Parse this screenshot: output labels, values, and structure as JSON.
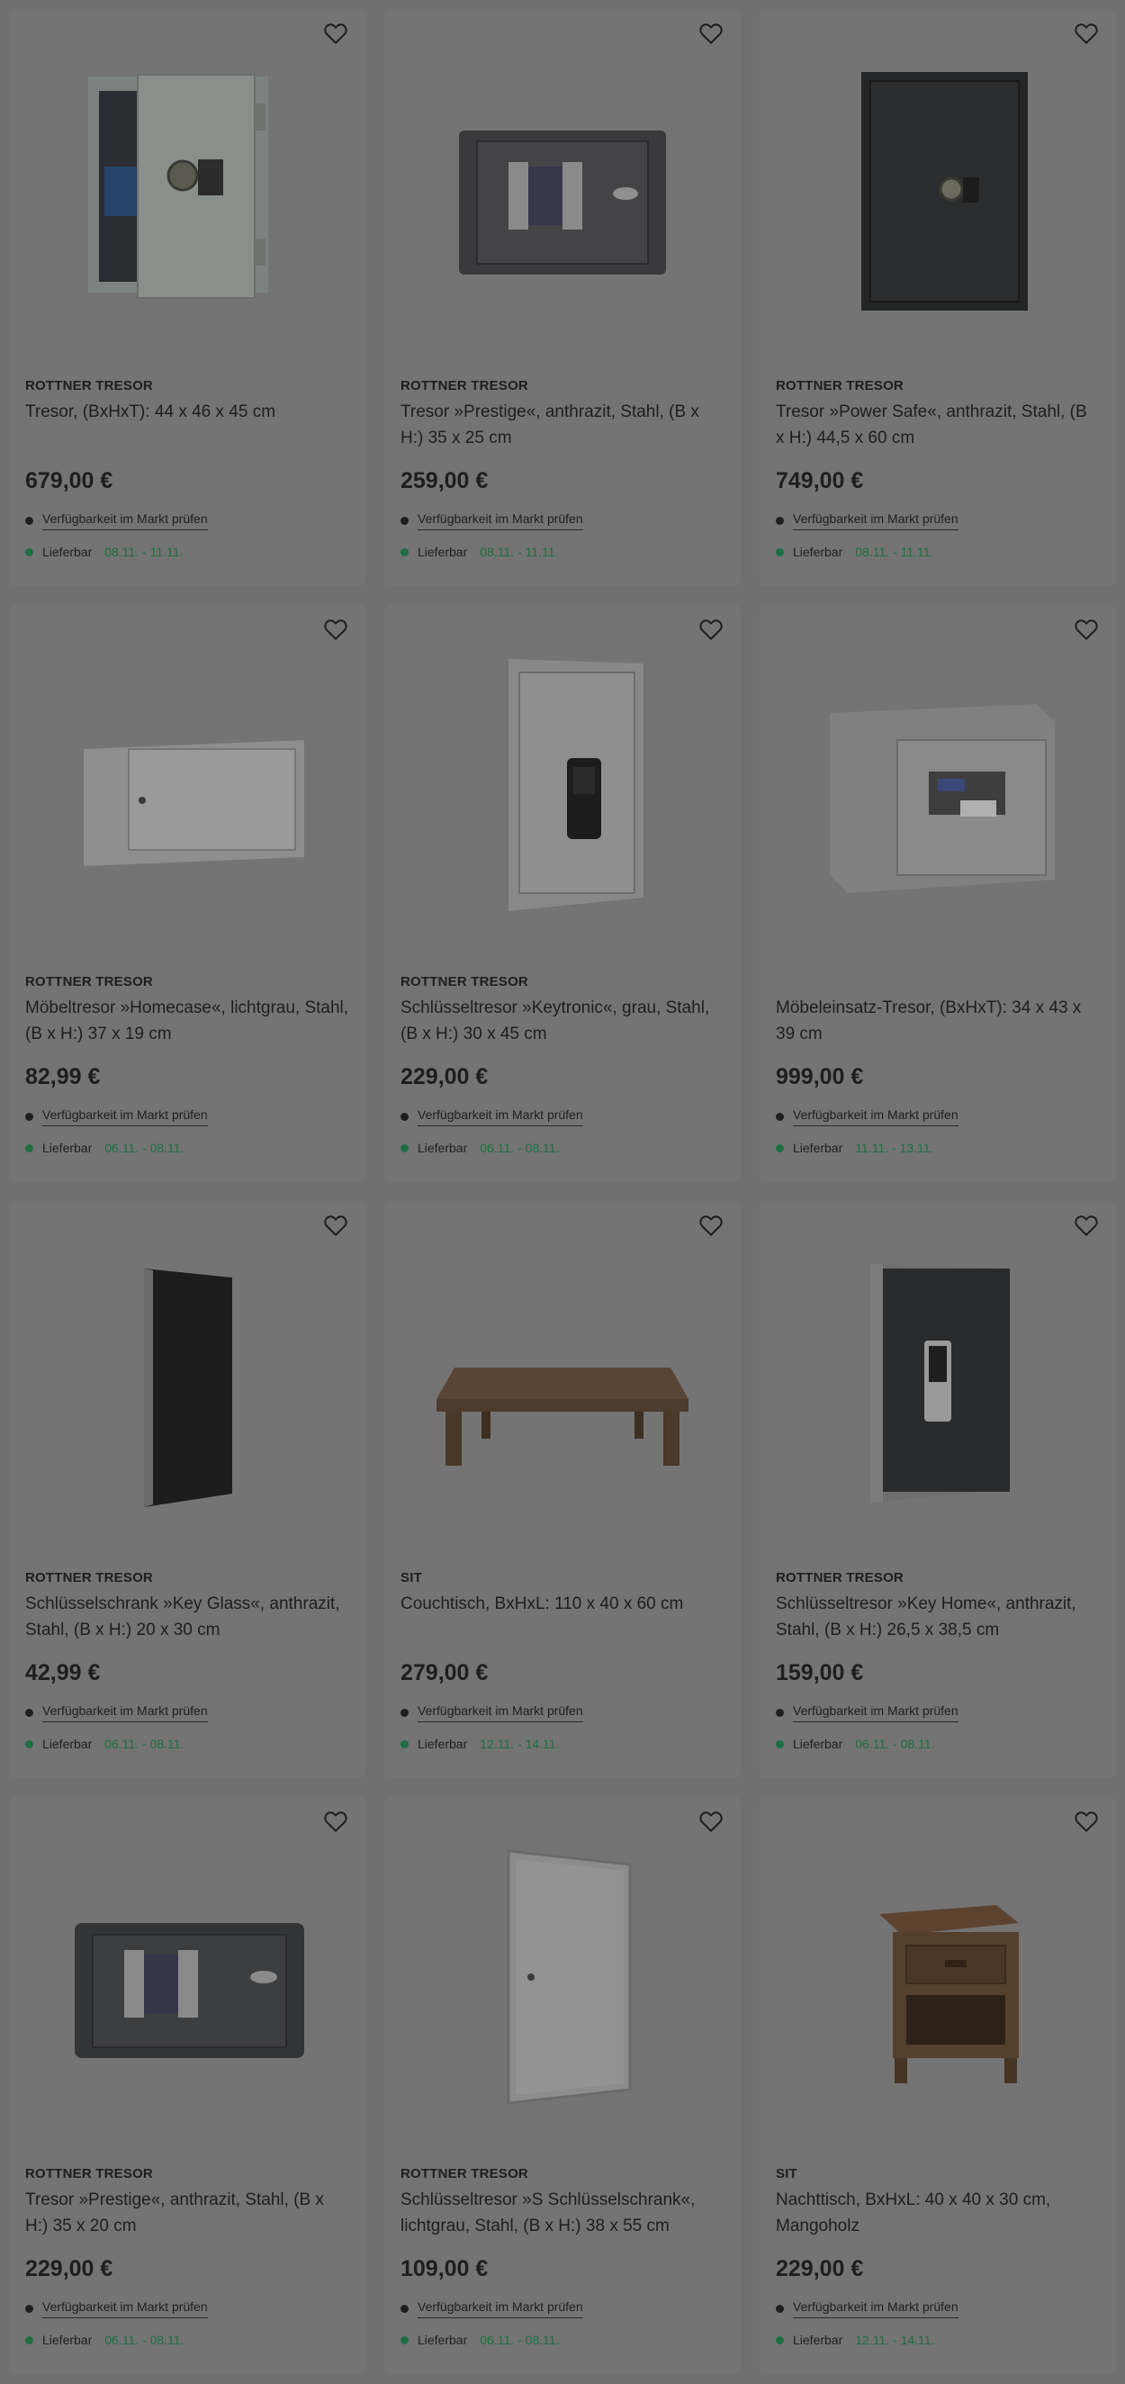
{
  "products": [
    {
      "brand": "ROTTNER TRESOR",
      "title": "Tresor, (BxHxT): 44 x 46 x 45 cm",
      "price": "679,00 €",
      "availability": "Verfügbarkeit im Markt prüfen",
      "delivery_label": "Lieferbar",
      "delivery_dates": "08.11. - 11.11.",
      "image": "safe-open-icon"
    },
    {
      "brand": "ROTTNER TRESOR",
      "title": "Tresor »Prestige«, anthrazit, Stahl, (B x H:) 35 x 25 cm",
      "price": "259,00 €",
      "availability": "Verfügbarkeit im Markt prüfen",
      "delivery_label": "Lieferbar",
      "delivery_dates": "08.11. - 11.11.",
      "image": "safe-wide-icon"
    },
    {
      "brand": "ROTTNER TRESOR",
      "title": "Tresor »Power Safe«, anthrazit, Stahl, (B x H:) 44,5 x 60 cm",
      "price": "749,00 €",
      "availability": "Verfügbarkeit im Markt prüfen",
      "delivery_label": "Lieferbar",
      "delivery_dates": "08.11. - 11.11.",
      "image": "safe-tall-icon"
    },
    {
      "brand": "ROTTNER TRESOR",
      "title": "Möbeltresor »Homecase«, lichtgrau, Stahl, (B x H:) 37 x 19 cm",
      "price": "82,99 €",
      "availability": "Verfügbarkeit im Markt prüfen",
      "delivery_label": "Lieferbar",
      "delivery_dates": "06.11. - 08.11.",
      "image": "furniture-safe-icon"
    },
    {
      "brand": "ROTTNER TRESOR",
      "title": "Schlüsseltresor »Keytronic«, grau, Stahl, (B x H:) 30 x 45 cm",
      "price": "229,00 €",
      "availability": "Verfügbarkeit im Markt prüfen",
      "delivery_label": "Lieferbar",
      "delivery_dates": "06.11. - 08.11.",
      "image": "key-safe-icon"
    },
    {
      "brand": "",
      "title": "Möbeleinsatz-Tresor, (BxHxT): 34 x 43 x 39 cm",
      "price": "999,00 €",
      "availability": "Verfügbarkeit im Markt prüfen",
      "delivery_label": "Lieferbar",
      "delivery_dates": "11.11. - 13.11.",
      "image": "insert-safe-icon"
    },
    {
      "brand": "ROTTNER TRESOR",
      "title": "Schlüsselschrank »Key Glass«, anthrazit, Stahl, (B x H:) 20 x 30 cm",
      "price": "42,99 €",
      "availability": "Verfügbarkeit im Markt prüfen",
      "delivery_label": "Lieferbar",
      "delivery_dates": "06.11. - 08.11.",
      "image": "key-cabinet-glass-icon"
    },
    {
      "brand": "SIT",
      "title": "Couchtisch, BxHxL: 110 x 40 x 60 cm",
      "price": "279,00 €",
      "availability": "Verfügbarkeit im Markt prüfen",
      "delivery_label": "Lieferbar",
      "delivery_dates": "12.11. - 14.11.",
      "image": "coffee-table-icon"
    },
    {
      "brand": "ROTTNER TRESOR",
      "title": "Schlüsseltresor »Key Home«, anthrazit, Stahl, (B x H:) 26,5 x 38,5 cm",
      "price": "159,00 €",
      "availability": "Verfügbarkeit im Markt prüfen",
      "delivery_label": "Lieferbar",
      "delivery_dates": "06.11. - 08.11.",
      "image": "key-home-safe-icon"
    },
    {
      "brand": "ROTTNER TRESOR",
      "title": "Tresor »Prestige«, anthrazit, Stahl, (B x H:) 35 x 20 cm",
      "price": "229,00 €",
      "availability": "Verfügbarkeit im Markt prüfen",
      "delivery_label": "Lieferbar",
      "delivery_dates": "06.11. - 08.11.",
      "image": "safe-wide-small-icon"
    },
    {
      "brand": "ROTTNER TRESOR",
      "title": "Schlüsseltresor »S Schlüsselschrank«, lichtgrau, Stahl, (B x H:) 38 x 55 cm",
      "price": "109,00 €",
      "availability": "Verfügbarkeit im Markt prüfen",
      "delivery_label": "Lieferbar",
      "delivery_dates": "06.11. - 08.11.",
      "image": "key-cabinet-icon"
    },
    {
      "brand": "SIT",
      "title": "Nachttisch, BxHxL: 40 x 40 x 30 cm, Mangoholz",
      "price": "229,00 €",
      "availability": "Verfügbarkeit im Markt prüfen",
      "delivery_label": "Lieferbar",
      "delivery_dates": "12.11. - 14.11.",
      "image": "nightstand-icon"
    }
  ]
}
